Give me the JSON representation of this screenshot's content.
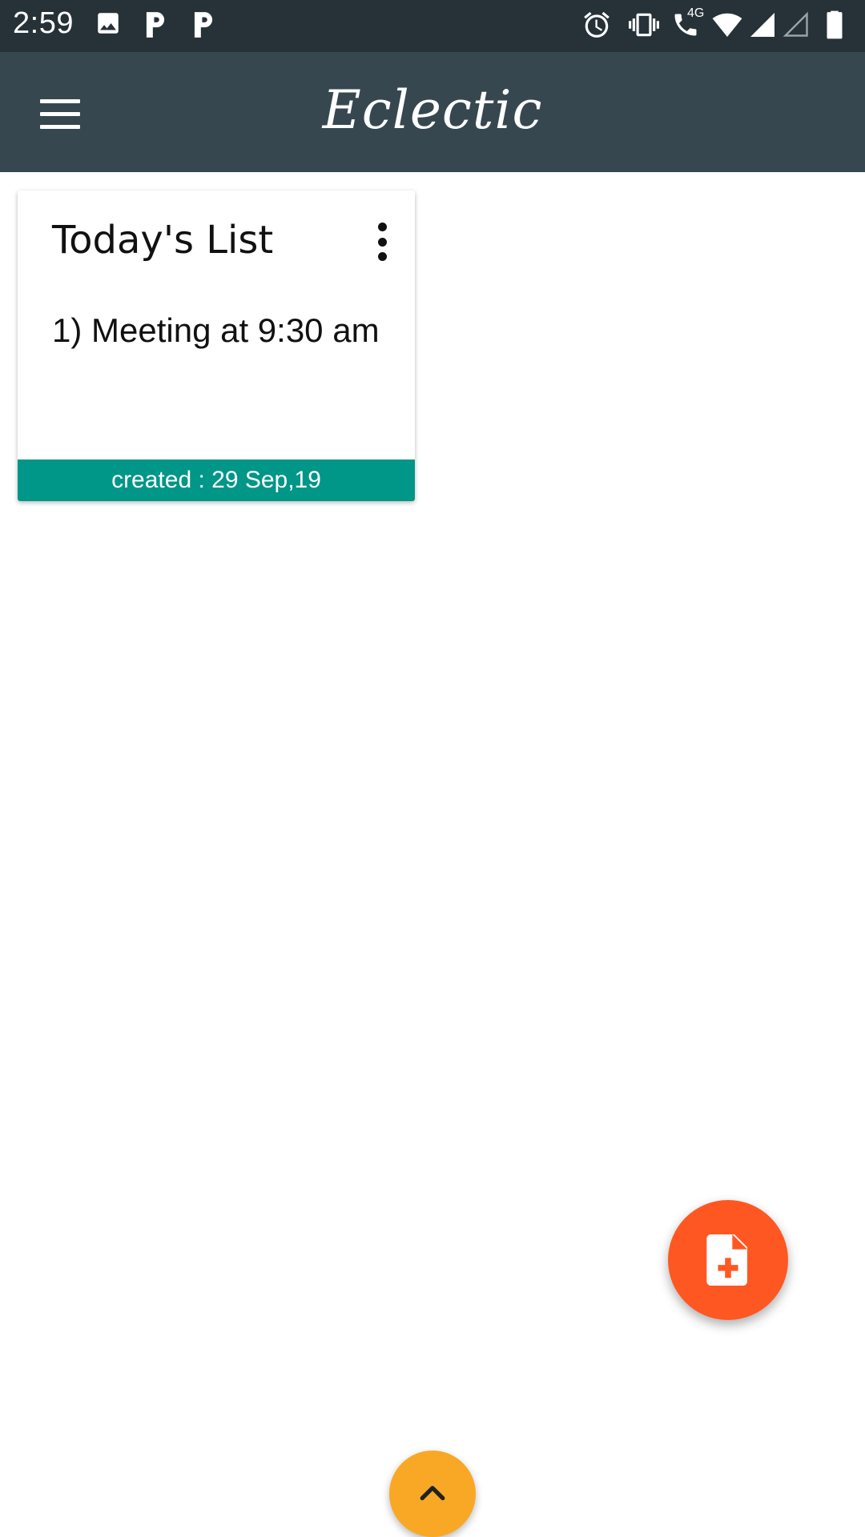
{
  "status_bar": {
    "time": "2:59",
    "network_label": "4G",
    "left_icons": [
      "image-icon",
      "parking-icon",
      "parking-icon"
    ],
    "right_icons": [
      "alarm-icon",
      "vibrate-icon",
      "wifi-call-icon",
      "wifi-icon",
      "signal-icon",
      "signal-empty-icon",
      "battery-icon"
    ]
  },
  "app_bar": {
    "title": "Eclectic",
    "menu_icon": "menu-icon"
  },
  "notes": [
    {
      "title": "Today's List",
      "body": "1) Meeting at 9:30 am",
      "footer": "created : 29 Sep,19",
      "menu_icon": "more-vert-icon"
    }
  ],
  "fab": {
    "add_note_icon": "note-add-icon",
    "scroll_up_icon": "chevron-up-icon"
  },
  "colors": {
    "status_bar": "#263238",
    "app_bar": "#37474f",
    "note_footer": "#009688",
    "fab_add": "#ff5722",
    "fab_up": "#f9a825"
  }
}
